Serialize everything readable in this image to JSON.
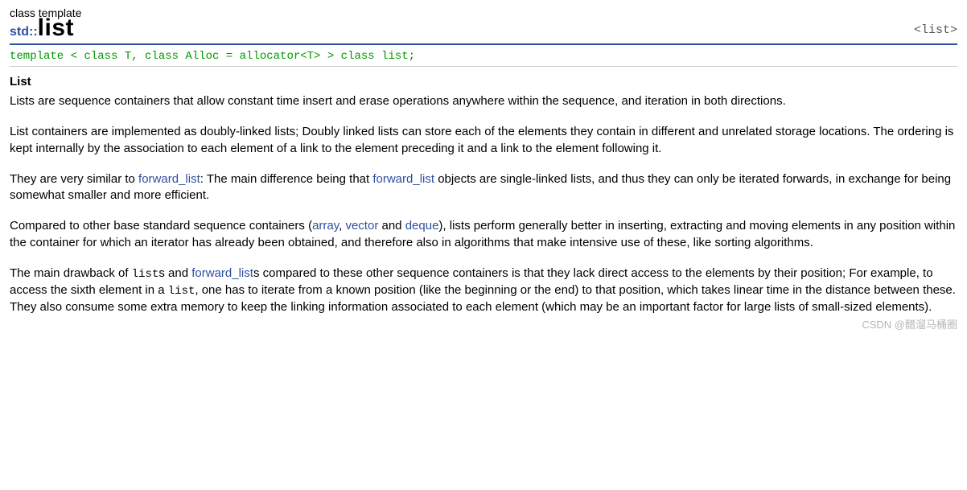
{
  "header": {
    "kind": "class template",
    "namespace": "std::",
    "name": "list",
    "tag": "<list>"
  },
  "template_decl": "template < class T, class Alloc = allocator<T> > class list;",
  "section_title": "List",
  "paragraphs": {
    "p1": "Lists are sequence containers that allow constant time insert and erase operations anywhere within the sequence, and iteration in both directions.",
    "p2": "List containers are implemented as doubly-linked lists; Doubly linked lists can store each of the elements they contain in different and unrelated storage locations. The ordering is kept internally by the association to each element of a link to the element preceding it and a link to the element following it.",
    "p3a": "They are very similar to ",
    "p3b": ": The main difference being that ",
    "p3c": " objects are single-linked lists, and thus they can only be iterated forwards, in exchange for being somewhat smaller and more efficient.",
    "p4a": "Compared to other base standard sequence containers (",
    "p4b": ", ",
    "p4c": " and ",
    "p4d": "), lists perform generally better in inserting, extracting and moving elements in any position within the container for which an iterator has already been obtained, and therefore also in algorithms that make intensive use of these, like sorting algorithms.",
    "p5a": "The main drawback of ",
    "p5b": "s and ",
    "p5c": "s compared to these other sequence containers is that they lack direct access to the elements by their position; For example, to access the sixth element in a ",
    "p5d": ", one has to iterate from a known position (like the beginning or the end) to that position, which takes linear time in the distance between these. They also consume some extra memory to keep the linking information associated to each element (which may be an important factor for large lists of small-sized elements)."
  },
  "links": {
    "forward_list": "forward_list",
    "array": "array",
    "vector": "vector",
    "deque": "deque"
  },
  "mono": {
    "list": "list"
  },
  "watermark": "CSDN @醋溜马桶圈"
}
